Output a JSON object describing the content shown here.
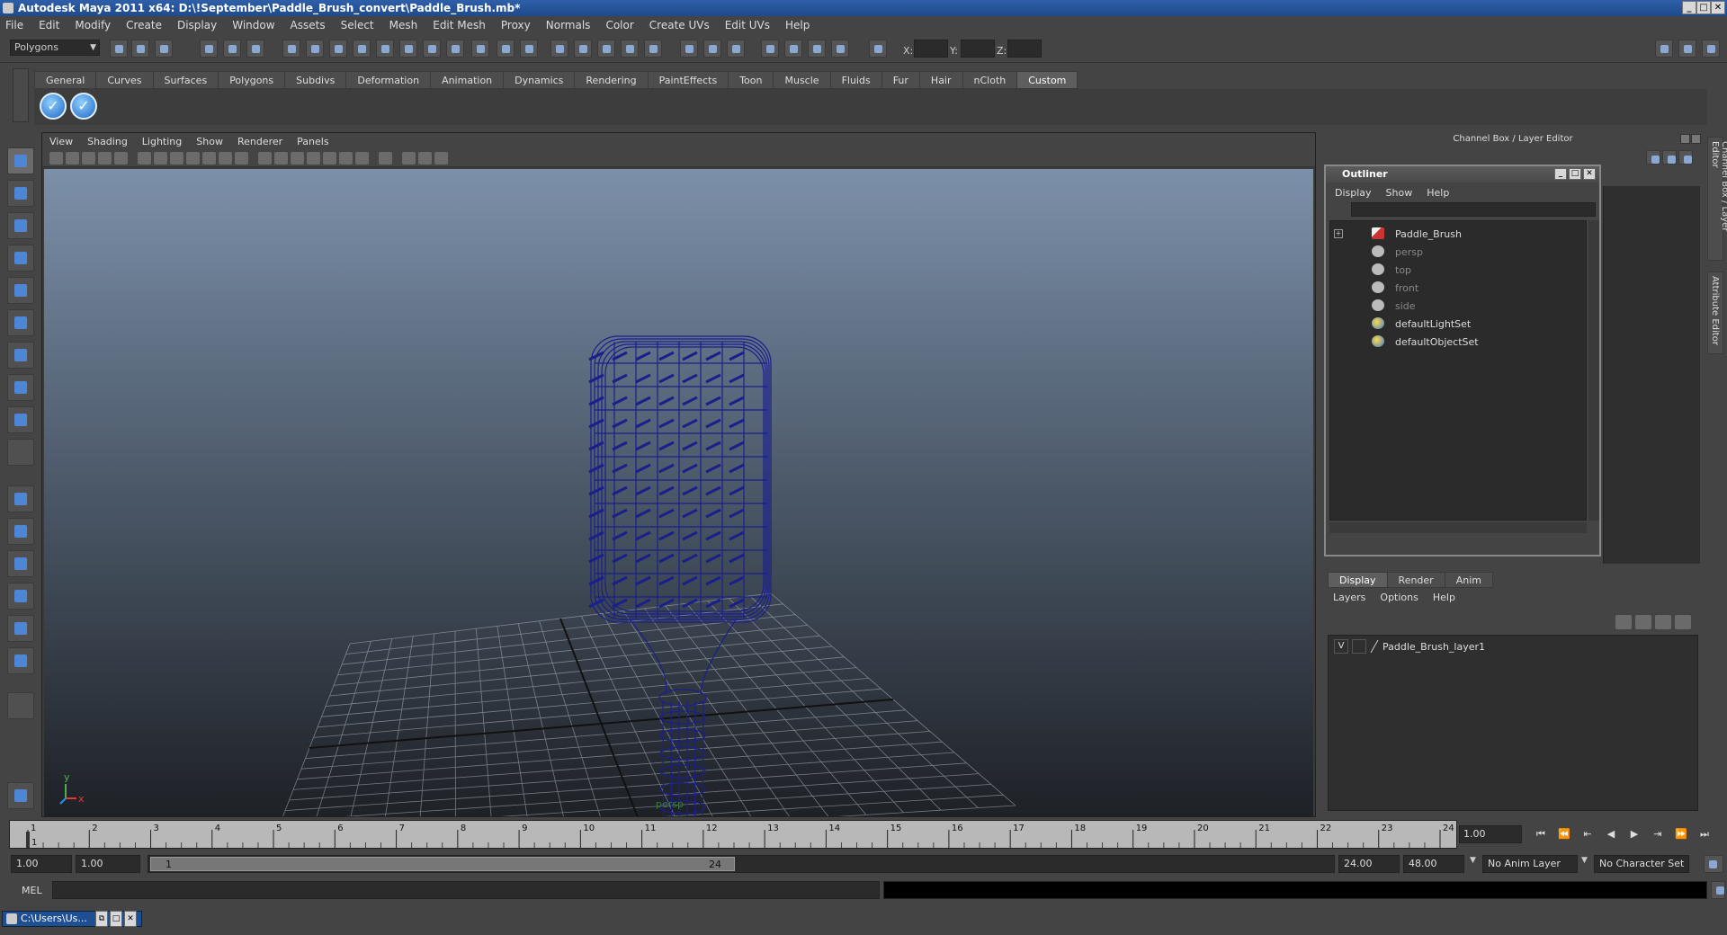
{
  "window": {
    "title": "Autodesk Maya 2011 x64: D:\\!September\\Paddle_Brush_convert\\Paddle_Brush.mb*",
    "minimize": "_",
    "maximize": "□",
    "close": "✕"
  },
  "menubar": [
    "File",
    "Edit",
    "Modify",
    "Create",
    "Display",
    "Window",
    "Assets",
    "Select",
    "Mesh",
    "Edit Mesh",
    "Proxy",
    "Normals",
    "Color",
    "Create UVs",
    "Edit UVs",
    "Help"
  ],
  "statusline": {
    "mode": "Polygons",
    "x_label": "X:",
    "y_label": "Y:",
    "z_label": "Z:"
  },
  "shelf": {
    "tabs": [
      "General",
      "Curves",
      "Surfaces",
      "Polygons",
      "Subdivs",
      "Deformation",
      "Animation",
      "Dynamics",
      "Rendering",
      "PaintEffects",
      "Toon",
      "Muscle",
      "Fluids",
      "Fur",
      "Hair",
      "nCloth",
      "Custom"
    ],
    "active_tab": "Custom",
    "icon_glyph": "✓"
  },
  "viewport": {
    "menu": [
      "View",
      "Shading",
      "Lighting",
      "Show",
      "Renderer",
      "Panels"
    ],
    "camera_label": "persp",
    "axis_x": "x",
    "axis_y": "y",
    "wire_color": "#1a1f8c"
  },
  "channel_box": {
    "title": "Channel Box / Layer Editor"
  },
  "outliner": {
    "title": "Outliner",
    "menu": [
      "Display",
      "Show",
      "Help"
    ],
    "items": [
      {
        "label": "Paddle_Brush",
        "kind": "mesh",
        "dim": false,
        "expand": "+"
      },
      {
        "label": "persp",
        "kind": "camera",
        "dim": true
      },
      {
        "label": "top",
        "kind": "camera",
        "dim": true
      },
      {
        "label": "front",
        "kind": "camera",
        "dim": true
      },
      {
        "label": "side",
        "kind": "camera",
        "dim": true
      },
      {
        "label": "defaultLightSet",
        "kind": "set",
        "dim": false
      },
      {
        "label": "defaultObjectSet",
        "kind": "set",
        "dim": false
      }
    ]
  },
  "layer_editor": {
    "tabs": [
      "Display",
      "Render",
      "Anim"
    ],
    "active_tab": "Display",
    "menu": [
      "Layers",
      "Options",
      "Help"
    ],
    "layers": [
      {
        "visible": "V",
        "name": "Paddle_Brush_layer1"
      }
    ]
  },
  "side_tabs": [
    "Channel Box / Layer Editor",
    "Attribute Editor"
  ],
  "timeline": {
    "start": 1,
    "end": 24,
    "current": 1,
    "ticks": [
      "1",
      "2",
      "3",
      "4",
      "5",
      "6",
      "7",
      "8",
      "9",
      "10",
      "11",
      "12",
      "13",
      "14",
      "15",
      "16",
      "17",
      "18",
      "19",
      "20",
      "21",
      "22",
      "23",
      "24"
    ],
    "current_frame_field": "1.00"
  },
  "range": {
    "start_time": "1.00",
    "playback_start": "1.00",
    "range_start_label": "1",
    "range_end_label": "24",
    "playback_end": "24.00",
    "end_time": "48.00",
    "anim_layer": "No Anim Layer",
    "character_set": "No Character Set"
  },
  "command_line": {
    "label": "MEL"
  },
  "taskbar": {
    "item": "C:\\Users\\Us...",
    "restore": "⧉",
    "maximize": "□",
    "close": "✕"
  }
}
